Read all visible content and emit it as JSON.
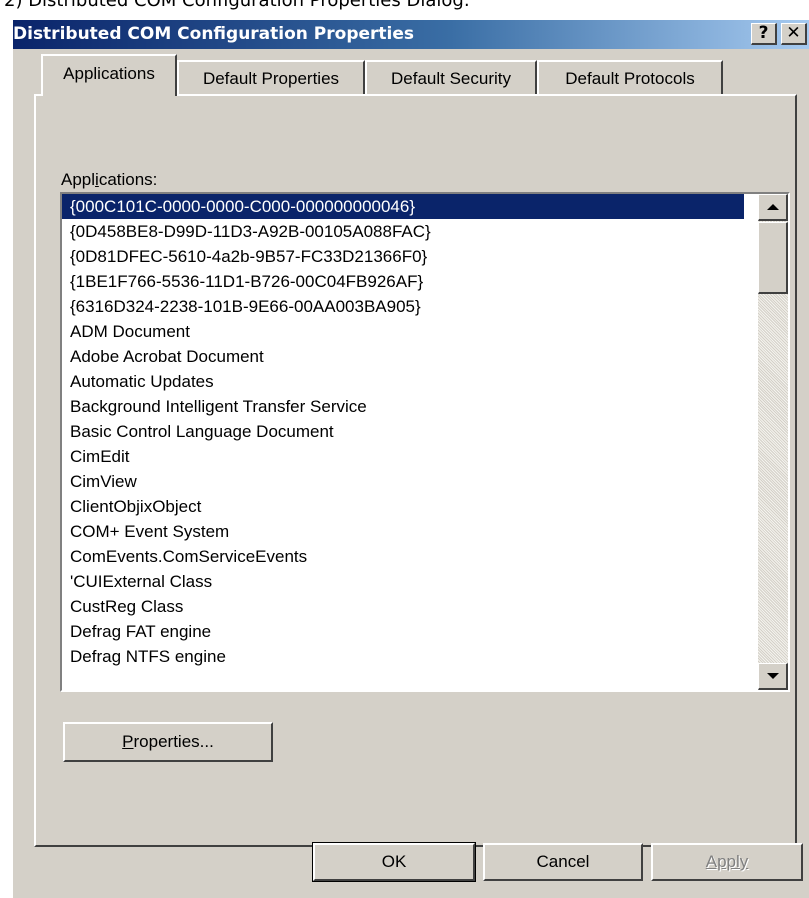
{
  "caption": "2)   Distributed COM Configuration Properties Dialog:",
  "window": {
    "title": "Distributed COM Configuration Properties",
    "help_button": "?",
    "close_button": "✕"
  },
  "tabs": [
    {
      "label": "Applications",
      "active": true
    },
    {
      "label": "Default Properties",
      "active": false
    },
    {
      "label": "Default Security",
      "active": false
    },
    {
      "label": "Default Protocols",
      "active": false
    }
  ],
  "applications": {
    "label_prefix": "Appl",
    "label_mnemonic": "i",
    "label_suffix": "cations:",
    "selected_index": 0,
    "items": [
      "{000C101C-0000-0000-C000-000000000046}",
      "{0D458BE8-D99D-11D3-A92B-00105A088FAC}",
      "{0D81DFEC-5610-4a2b-9B57-FC33D21366F0}",
      "{1BE1F766-5536-11D1-B726-00C04FB926AF}",
      "{6316D324-2238-101B-9E66-00AA003BA905}",
      "ADM Document",
      "Adobe Acrobat Document",
      "Automatic Updates",
      "Background Intelligent Transfer Service",
      "Basic Control Language Document",
      "CimEdit",
      "CimView",
      "ClientObjixObject",
      "COM+ Event System",
      "ComEvents.ComServiceEvents",
      "'CUIExternal Class",
      "CustReg Class",
      "Defrag FAT engine",
      "Defrag NTFS engine"
    ]
  },
  "buttons": {
    "properties_mnemonic": "P",
    "properties_rest": "roperties...",
    "ok": "OK",
    "cancel": "Cancel",
    "apply": "Apply"
  },
  "colors": {
    "selection": "#0a246a",
    "face": "#d4d0c8"
  }
}
